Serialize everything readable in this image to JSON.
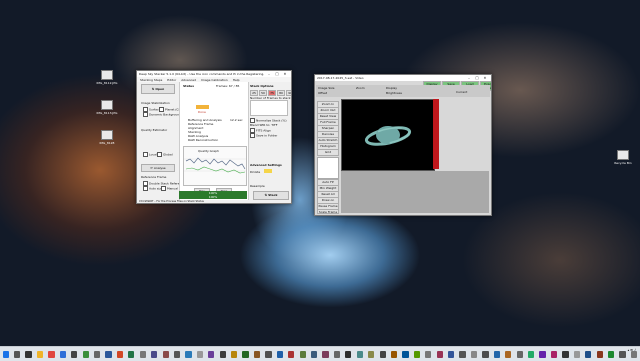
{
  "desktop": {
    "icons": [
      {
        "label": "IMG_8112.JPG",
        "icon": "file-icon"
      },
      {
        "label": "IMG_8113.JPG",
        "icon": "file-icon"
      },
      {
        "label": "IMG_8128",
        "icon": "file-icon"
      },
      {
        "label": "Recycle Bin",
        "icon": "recycle-bin-icon"
      }
    ]
  },
  "dss": {
    "title": "Deep Sky Stacker 5.1.0 (64-bit)  – Use the icon commands and Pi in the Registering, SRO, or Play...",
    "menu": [
      "Stacking Steps",
      "Editor",
      "Advanced",
      "Image Calibration",
      "Help"
    ],
    "open_label": "Open",
    "image_stabilization": "Image Stabilization",
    "surface_label": "Surface",
    "planet_label": "Planet (COG)",
    "dynamic_bg_label": "Dynamic Background",
    "quality_estimator": "Quality Estimator",
    "local_label": "Local",
    "global_label": "Global",
    "analyse_label": "Analyse",
    "reference_frame": "Reference Frame",
    "double_stack_label": "Double Stack Reference",
    "auto_label": "Auto size",
    "manual_label": "Manual Size",
    "status_label": "Status",
    "status_text": "Done",
    "frames_label": "Frames: 67 / 85",
    "list": [
      "Buffering and Analysis",
      "Reference Frame",
      "Alignment",
      "Stacking",
      "RAW Analysis",
      "RAW Reconstruction"
    ],
    "time_value": "12.2 sec",
    "chart_title": "Quality Graph",
    "play_label": "Play",
    "stop_label": "Stop",
    "progress": [
      "100%",
      "100%"
    ],
    "stack_options": "Stack Options",
    "stack_values": [
      "25",
      "50",
      "75",
      "80",
      "90"
    ],
    "num_frames_label": "Number of Frames to stack",
    "normalize_label": "Normalize Stack (%)",
    "blend_label": "Blend SER to: TIFF",
    "fits_label": "FITS Align",
    "save_label": "Save in Folder",
    "stack_button": "Stack",
    "advanced_settings": "Advanced Settings",
    "drizzle_label": "Drizzle",
    "resample_label": "Resample",
    "footer": "Ctrl-SMART – For the Process Files on Stack Status"
  },
  "sharpcap": {
    "title": "2017-08-17-2045_3-sat - Video",
    "top_tabs": [
      "Display Option",
      "Save Settings",
      "Load Settings",
      "Export Preview"
    ],
    "image_size": "Image Size",
    "display_label": "Display",
    "offset_label": "Offset",
    "brightness_label": "Brightness",
    "zoom_label": "Zoom",
    "current_label": "Current",
    "tools": [
      "Zoom In",
      "Zoom Out",
      "Reset View",
      "Full Frame",
      "Sharpen",
      "Denoise",
      "Auto Stretch",
      "Histogram",
      "Grid"
    ],
    "bottom_tools": [
      "Auto FP",
      "Min Weight",
      "Reset All",
      "Draw on Canvas",
      "Pause Frame",
      "Scale Frame"
    ]
  }
}
